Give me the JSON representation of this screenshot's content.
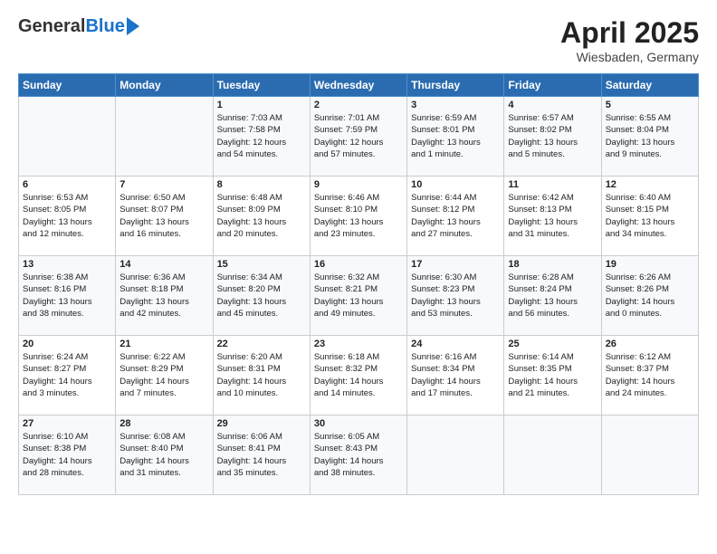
{
  "header": {
    "logo_general": "General",
    "logo_blue": "Blue",
    "title": "April 2025",
    "location": "Wiesbaden, Germany"
  },
  "weekdays": [
    "Sunday",
    "Monday",
    "Tuesday",
    "Wednesday",
    "Thursday",
    "Friday",
    "Saturday"
  ],
  "weeks": [
    [
      {
        "day": "",
        "info": ""
      },
      {
        "day": "",
        "info": ""
      },
      {
        "day": "1",
        "info": "Sunrise: 7:03 AM\nSunset: 7:58 PM\nDaylight: 12 hours\nand 54 minutes."
      },
      {
        "day": "2",
        "info": "Sunrise: 7:01 AM\nSunset: 7:59 PM\nDaylight: 12 hours\nand 57 minutes."
      },
      {
        "day": "3",
        "info": "Sunrise: 6:59 AM\nSunset: 8:01 PM\nDaylight: 13 hours\nand 1 minute."
      },
      {
        "day": "4",
        "info": "Sunrise: 6:57 AM\nSunset: 8:02 PM\nDaylight: 13 hours\nand 5 minutes."
      },
      {
        "day": "5",
        "info": "Sunrise: 6:55 AM\nSunset: 8:04 PM\nDaylight: 13 hours\nand 9 minutes."
      }
    ],
    [
      {
        "day": "6",
        "info": "Sunrise: 6:53 AM\nSunset: 8:05 PM\nDaylight: 13 hours\nand 12 minutes."
      },
      {
        "day": "7",
        "info": "Sunrise: 6:50 AM\nSunset: 8:07 PM\nDaylight: 13 hours\nand 16 minutes."
      },
      {
        "day": "8",
        "info": "Sunrise: 6:48 AM\nSunset: 8:09 PM\nDaylight: 13 hours\nand 20 minutes."
      },
      {
        "day": "9",
        "info": "Sunrise: 6:46 AM\nSunset: 8:10 PM\nDaylight: 13 hours\nand 23 minutes."
      },
      {
        "day": "10",
        "info": "Sunrise: 6:44 AM\nSunset: 8:12 PM\nDaylight: 13 hours\nand 27 minutes."
      },
      {
        "day": "11",
        "info": "Sunrise: 6:42 AM\nSunset: 8:13 PM\nDaylight: 13 hours\nand 31 minutes."
      },
      {
        "day": "12",
        "info": "Sunrise: 6:40 AM\nSunset: 8:15 PM\nDaylight: 13 hours\nand 34 minutes."
      }
    ],
    [
      {
        "day": "13",
        "info": "Sunrise: 6:38 AM\nSunset: 8:16 PM\nDaylight: 13 hours\nand 38 minutes."
      },
      {
        "day": "14",
        "info": "Sunrise: 6:36 AM\nSunset: 8:18 PM\nDaylight: 13 hours\nand 42 minutes."
      },
      {
        "day": "15",
        "info": "Sunrise: 6:34 AM\nSunset: 8:20 PM\nDaylight: 13 hours\nand 45 minutes."
      },
      {
        "day": "16",
        "info": "Sunrise: 6:32 AM\nSunset: 8:21 PM\nDaylight: 13 hours\nand 49 minutes."
      },
      {
        "day": "17",
        "info": "Sunrise: 6:30 AM\nSunset: 8:23 PM\nDaylight: 13 hours\nand 53 minutes."
      },
      {
        "day": "18",
        "info": "Sunrise: 6:28 AM\nSunset: 8:24 PM\nDaylight: 13 hours\nand 56 minutes."
      },
      {
        "day": "19",
        "info": "Sunrise: 6:26 AM\nSunset: 8:26 PM\nDaylight: 14 hours\nand 0 minutes."
      }
    ],
    [
      {
        "day": "20",
        "info": "Sunrise: 6:24 AM\nSunset: 8:27 PM\nDaylight: 14 hours\nand 3 minutes."
      },
      {
        "day": "21",
        "info": "Sunrise: 6:22 AM\nSunset: 8:29 PM\nDaylight: 14 hours\nand 7 minutes."
      },
      {
        "day": "22",
        "info": "Sunrise: 6:20 AM\nSunset: 8:31 PM\nDaylight: 14 hours\nand 10 minutes."
      },
      {
        "day": "23",
        "info": "Sunrise: 6:18 AM\nSunset: 8:32 PM\nDaylight: 14 hours\nand 14 minutes."
      },
      {
        "day": "24",
        "info": "Sunrise: 6:16 AM\nSunset: 8:34 PM\nDaylight: 14 hours\nand 17 minutes."
      },
      {
        "day": "25",
        "info": "Sunrise: 6:14 AM\nSunset: 8:35 PM\nDaylight: 14 hours\nand 21 minutes."
      },
      {
        "day": "26",
        "info": "Sunrise: 6:12 AM\nSunset: 8:37 PM\nDaylight: 14 hours\nand 24 minutes."
      }
    ],
    [
      {
        "day": "27",
        "info": "Sunrise: 6:10 AM\nSunset: 8:38 PM\nDaylight: 14 hours\nand 28 minutes."
      },
      {
        "day": "28",
        "info": "Sunrise: 6:08 AM\nSunset: 8:40 PM\nDaylight: 14 hours\nand 31 minutes."
      },
      {
        "day": "29",
        "info": "Sunrise: 6:06 AM\nSunset: 8:41 PM\nDaylight: 14 hours\nand 35 minutes."
      },
      {
        "day": "30",
        "info": "Sunrise: 6:05 AM\nSunset: 8:43 PM\nDaylight: 14 hours\nand 38 minutes."
      },
      {
        "day": "",
        "info": ""
      },
      {
        "day": "",
        "info": ""
      },
      {
        "day": "",
        "info": ""
      }
    ]
  ]
}
